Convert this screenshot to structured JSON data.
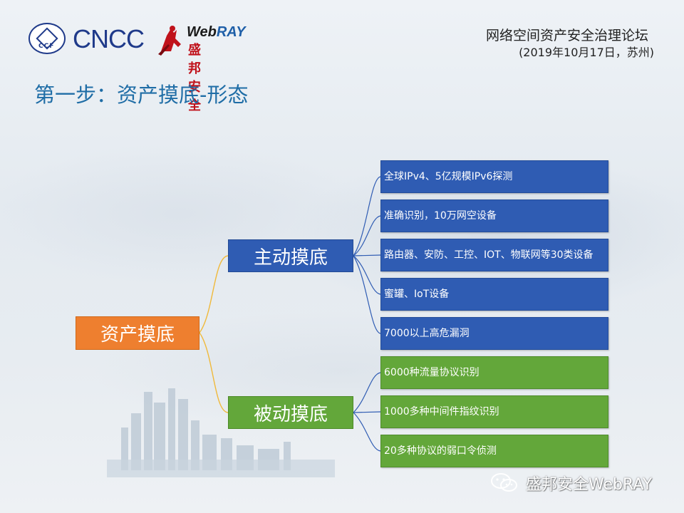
{
  "header": {
    "left_logo_text": "CNCC",
    "ccf_text": "CCF",
    "webray_name_web": "Web",
    "webray_name_ray": "RAY",
    "webray_cn": "盛邦安全",
    "forum_title": "网络空间资产安全治理论坛",
    "forum_subtitle": "(2019年10月17日，苏州)"
  },
  "slide_title": "第一步：资产摸底-形态",
  "diagram": {
    "root": "资产摸底",
    "branches": [
      {
        "label": "主动摸底",
        "color": "#2f5cb3",
        "children": [
          "全球IPv4、5亿规模IPv6探测",
          "准确识别，10万网空设备",
          "路由器、安防、工控、IOT、物联网等30类设备",
          "蜜罐、IoT设备",
          "7000以上高危漏洞"
        ]
      },
      {
        "label": "被动摸底",
        "color": "#63a73a",
        "children": [
          "6000种流量协议识别",
          "1000多种中间件指纹识别",
          "20多种协议的弱口令侦测"
        ]
      }
    ]
  },
  "watermark": {
    "text": "盛邦安全WebRAY",
    "icon": "wechat-icon"
  },
  "colors": {
    "root": "#ee7f2f",
    "active": "#2f5cb3",
    "passive": "#63a73a",
    "title": "#1f6da6"
  }
}
